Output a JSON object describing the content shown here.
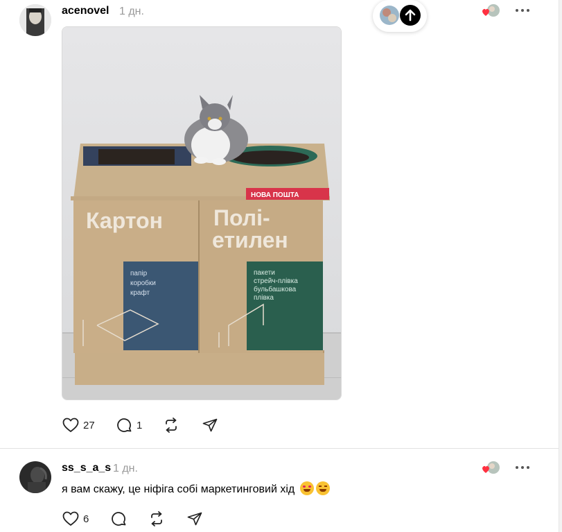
{
  "post": {
    "username": "acenovel",
    "time": "1 дн.",
    "image": {
      "sign_left": "Картон",
      "sign_right_line1": "Полі-",
      "sign_right_line2": "етилен",
      "brand_strip": "НОВА ПОШТА",
      "left_panel": [
        "папір",
        "коробки",
        "крафт"
      ],
      "right_panel": [
        "пакети",
        "стрейч-плівка",
        "бульбашкова",
        "плівка"
      ]
    },
    "actions": {
      "like_count": "27",
      "reply_count": "1"
    }
  },
  "comment": {
    "username": "ss_s_a_s",
    "time": "1 дн.",
    "text": "я вам скажу, це ніфіга собі маркетинговий хід",
    "emojis": [
      "smiling-face-with-hearts",
      "rolling-on-the-floor-laughing"
    ],
    "actions": {
      "like_count": "6"
    }
  },
  "icons": [
    "more-icon",
    "heart-icon",
    "comment-icon",
    "repost-icon",
    "share-icon",
    "arrow-up-icon"
  ],
  "colors": {
    "like": "#ff3040",
    "muted": "#999999",
    "text": "#000000"
  }
}
